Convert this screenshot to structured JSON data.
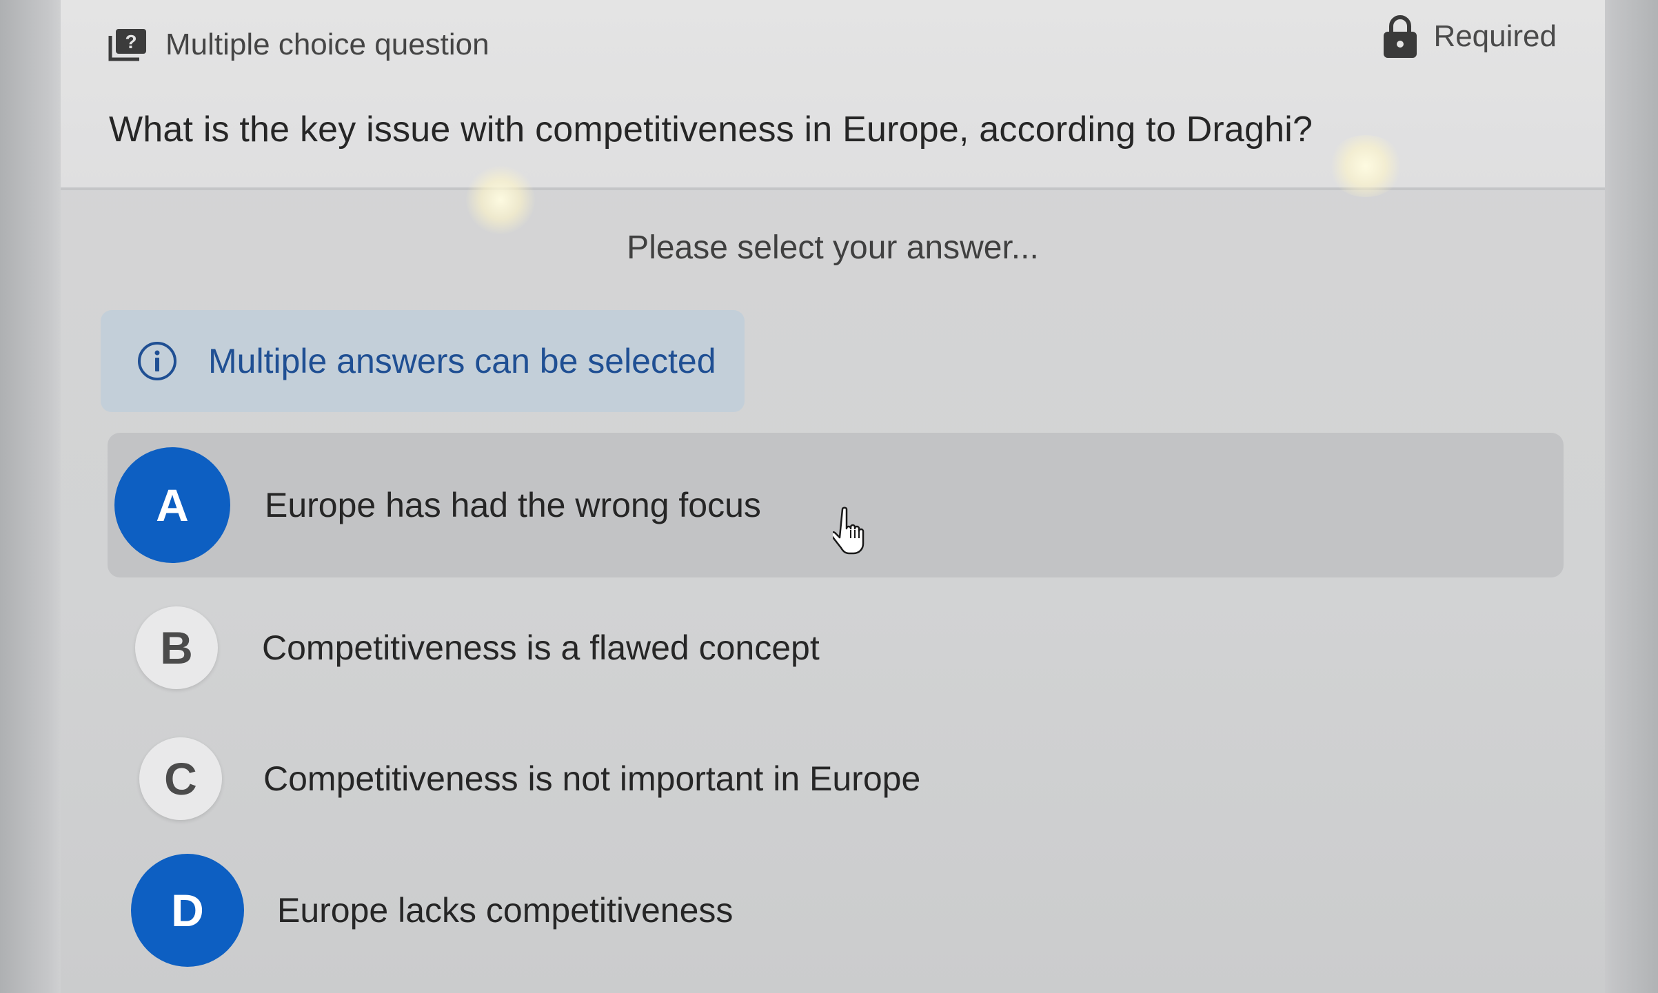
{
  "header": {
    "question_type": "Multiple choice question",
    "question_type_icon": "question-card-icon",
    "required_label": "Required",
    "required_icon": "lock-icon",
    "question_text": "What is the key issue with competitiveness in Europe, according to Draghi?"
  },
  "body": {
    "prompt": "Please select your answer...",
    "info": {
      "icon": "info-icon",
      "text": "Multiple answers can be selected"
    },
    "options": [
      {
        "letter": "A",
        "text": "Europe has had the wrong focus",
        "selected": true,
        "hovered": true
      },
      {
        "letter": "B",
        "text": "Competitiveness is a flawed concept",
        "selected": false,
        "hovered": false
      },
      {
        "letter": "C",
        "text": "Competitiveness is not important in Europe",
        "selected": false,
        "hovered": false
      },
      {
        "letter": "D",
        "text": "Europe lacks competitiveness",
        "selected": true,
        "hovered": false
      }
    ]
  },
  "colors": {
    "selected_badge": "#0d5fc2",
    "info_text": "#1f4f93",
    "info_background": "#c3cfd9"
  },
  "cursor": "hand-pointer-icon"
}
